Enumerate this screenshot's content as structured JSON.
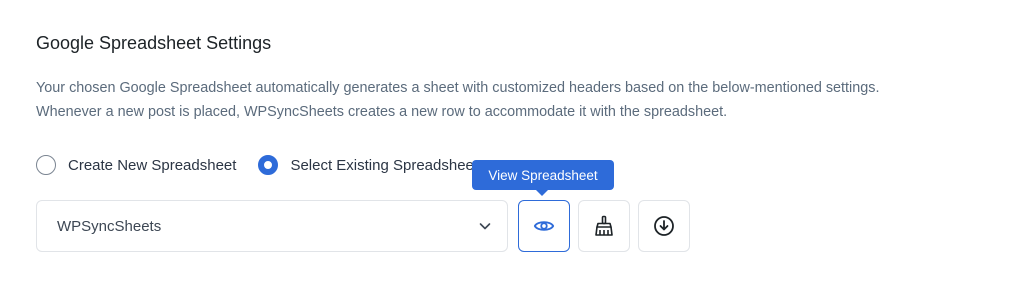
{
  "section": {
    "title": "Google Spreadsheet Settings",
    "description_line1": "Your chosen Google Spreadsheet automatically generates a sheet with customized headers based on the below-mentioned settings.",
    "description_line2": "Whenever a new post is placed, WPSyncSheets creates a new row to accommodate it with the spreadsheet."
  },
  "options": {
    "create_label": "Create New Spreadsheet",
    "select_label": "Select Existing Spreadsheet",
    "selected": "select"
  },
  "spreadsheet_select": {
    "value": "WPSyncSheets",
    "icon": "chevron-down-icon"
  },
  "actions": {
    "view": {
      "icon": "eye-icon",
      "tooltip": "View Spreadsheet"
    },
    "clear": {
      "icon": "broom-icon"
    },
    "download": {
      "icon": "download-icon"
    }
  },
  "colors": {
    "accent": "#2e6bd9",
    "text": "#1d2327",
    "muted": "#5b6b7c",
    "border": "#e1e4e8"
  }
}
